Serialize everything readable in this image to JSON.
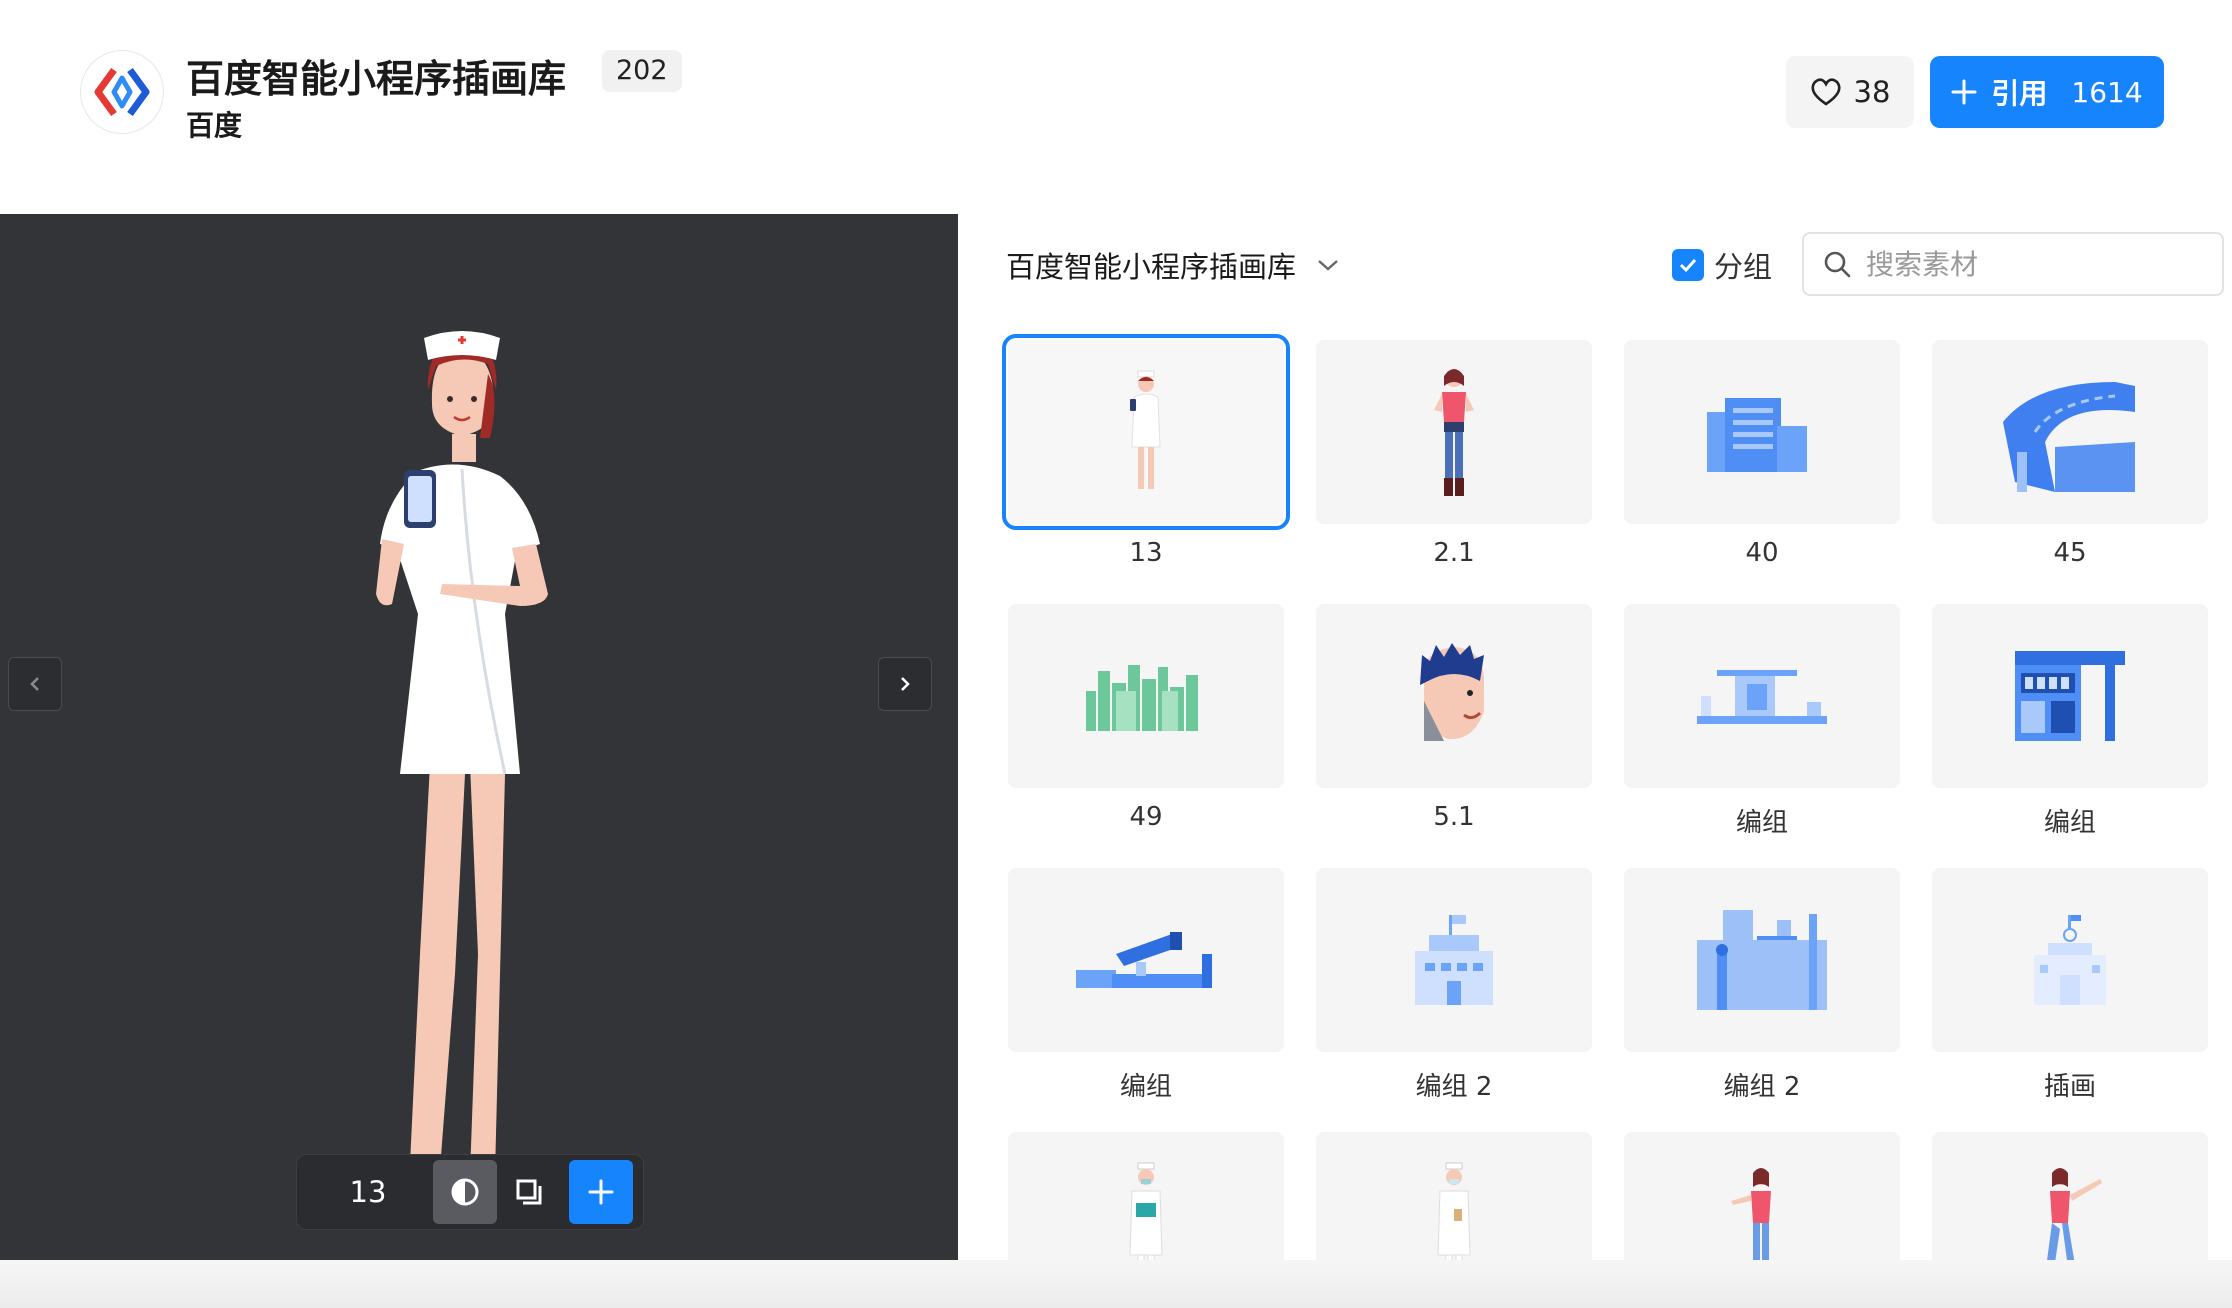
{
  "header": {
    "title": "百度智能小程序插画库",
    "count_badge": "202",
    "author": "百度",
    "likes": "38",
    "cite_label": "引用",
    "cite_count": "1614",
    "accent": "#1684fc"
  },
  "preview": {
    "current_name": "13",
    "bg_color": "#333438"
  },
  "panel": {
    "library_select": "百度智能小程序插画库",
    "group_label": "分组",
    "group_checked": true,
    "search_placeholder": "搜索素材"
  },
  "items": [
    {
      "label": "13",
      "icon": "nurse-illustration"
    },
    {
      "label": "2.1",
      "icon": "woman-standing-illustration"
    },
    {
      "label": "40",
      "icon": "blue-building-illustration"
    },
    {
      "label": "45",
      "icon": "blue-road-illustration"
    },
    {
      "label": "49",
      "icon": "green-city-illustration"
    },
    {
      "label": "5.1",
      "icon": "man-face-illustration"
    },
    {
      "label": "编组",
      "icon": "bus-stop-illustration"
    },
    {
      "label": "编组",
      "icon": "atm-machine-illustration"
    },
    {
      "label": "编组",
      "icon": "camera-illustration"
    },
    {
      "label": "编组 2",
      "icon": "school-building-illustration"
    },
    {
      "label": "编组 2",
      "icon": "city-skyline-illustration"
    },
    {
      "label": "插画",
      "icon": "hospital-illustration"
    },
    {
      "label": "",
      "icon": "doctor-mask-illustration"
    },
    {
      "label": "",
      "icon": "nurse-mask-illustration"
    },
    {
      "label": "",
      "icon": "woman-pointing-illustration"
    },
    {
      "label": "",
      "icon": "woman-walking-illustration"
    }
  ]
}
